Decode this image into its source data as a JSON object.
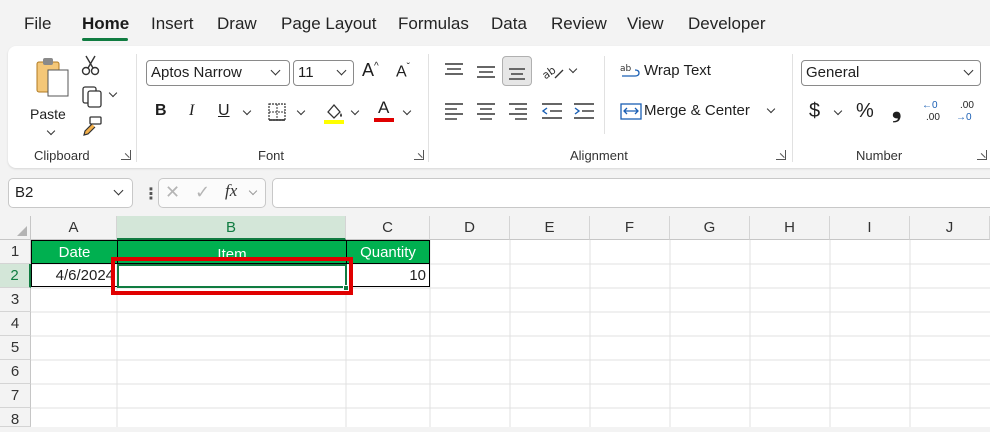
{
  "menu": {
    "items": [
      "File",
      "Home",
      "Insert",
      "Draw",
      "Page Layout",
      "Formulas",
      "Data",
      "Review",
      "View",
      "Developer"
    ],
    "active": "Home"
  },
  "ribbon": {
    "clipboard": {
      "paste_label": "Paste",
      "group_label": "Clipboard"
    },
    "font": {
      "family": "Aptos Narrow",
      "size": "11",
      "bold": "B",
      "italic": "I",
      "underline": "U",
      "grow": "A",
      "shrink": "A",
      "font_color_letter": "A",
      "group_label": "Font",
      "highlight_color": "#ffff00",
      "font_color": "#e00000"
    },
    "alignment": {
      "wrap_text": "Wrap Text",
      "merge_center": "Merge & Center",
      "group_label": "Alignment"
    },
    "number": {
      "format": "General",
      "currency": "$",
      "percent": "%",
      "comma": "❟",
      "inc_decimal": ".00",
      "inc_decimal_top": "←0",
      "dec_decimal_top": ".00",
      "dec_decimal": "→0",
      "group_label": "Number"
    }
  },
  "formula_bar": {
    "name_box": "B2",
    "fx": "fx",
    "value": ""
  },
  "grid": {
    "columns": [
      "A",
      "B",
      "C",
      "D",
      "E",
      "F",
      "G",
      "H",
      "I",
      "J"
    ],
    "rows": [
      "1",
      "2",
      "3",
      "4",
      "5",
      "6",
      "7",
      "8"
    ],
    "selected_column": "B",
    "selected_row": "2",
    "cells": {
      "A1": "Date",
      "B1": "Item",
      "C1": "Quantity",
      "A2": "4/6/2024",
      "B2": "",
      "C2": "10"
    },
    "header_fill": "#00b050",
    "highlight_color": "#e00000"
  }
}
